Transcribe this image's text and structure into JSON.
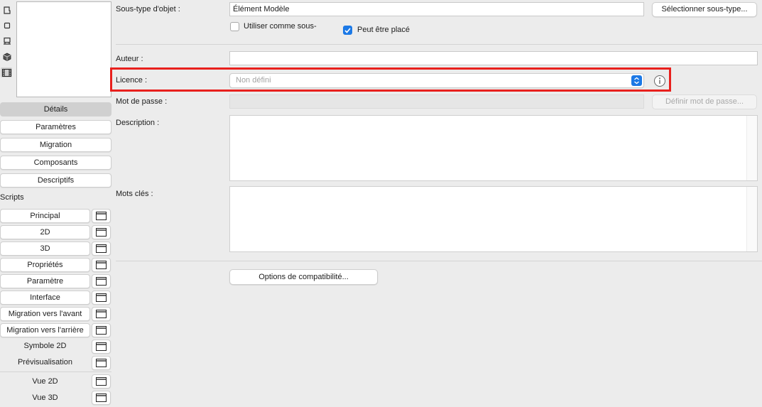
{
  "sidebar": {
    "icons": [
      "box-outline-icon",
      "square-icon",
      "floor-plan-icon",
      "cube-icon",
      "film-strip-icon"
    ],
    "nav": [
      {
        "label": "Détails",
        "selected": true
      },
      {
        "label": "Paramètres"
      },
      {
        "label": "Migration"
      },
      {
        "label": "Composants"
      },
      {
        "label": "Descriptifs"
      }
    ],
    "scripts_label": "Scripts",
    "scripts": [
      {
        "label": "Principal"
      },
      {
        "label": "2D"
      },
      {
        "label": "3D"
      },
      {
        "label": "Propriétés"
      },
      {
        "label": "Paramètre"
      },
      {
        "label": "Interface"
      },
      {
        "label": "Migration vers l'avant"
      },
      {
        "label": "Migration vers l'arrière"
      },
      {
        "label": "Symbole 2D"
      },
      {
        "label": "Prévisualisation"
      },
      {
        "label": "Vue 2D"
      },
      {
        "label": "Vue 3D"
      }
    ]
  },
  "form": {
    "subtype_label": "Sous-type d'objet :",
    "subtype_value": "Élément Modèle",
    "select_subtype_button": "Sélectionner sous-type...",
    "use_as_sub_label": "Utiliser comme sous-",
    "use_as_sub_checked": false,
    "placeable_label": "Peut être placé",
    "placeable_checked": true,
    "author_label": "Auteur :",
    "author_value": "",
    "license_label": "Licence :",
    "license_value": "Non défini",
    "password_label": "Mot de passe :",
    "set_password_button": "Définir mot de passe...",
    "description_label": "Description :",
    "keywords_label": "Mots clés :",
    "compat_button": "Options de compatibilité..."
  },
  "colors": {
    "accent": "#1c79e6",
    "highlight": "#e8201d"
  }
}
